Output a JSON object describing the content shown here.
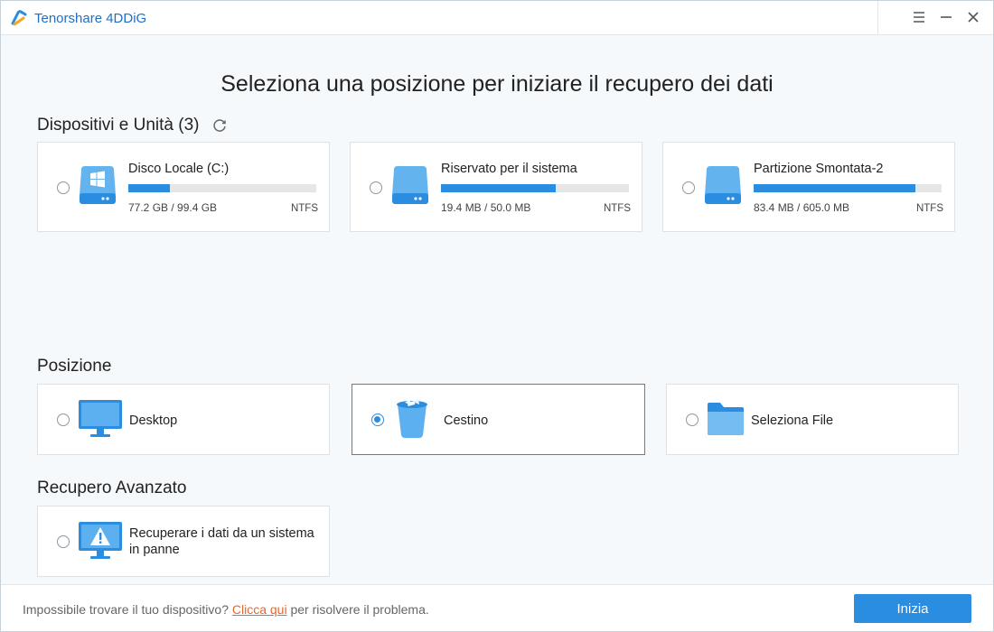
{
  "app": {
    "title": "Tenorshare 4DDiG"
  },
  "page": {
    "title": "Seleziona una posizione per iniziare il recupero dei dati"
  },
  "devices": {
    "section_title": "Dispositivi e Unità (3)",
    "items": [
      {
        "name": "Disco Locale (C:)",
        "size": "77.2 GB / 99.4 GB",
        "fs": "NTFS",
        "usage": 0.22,
        "icon": "windows-drive-icon",
        "selected": false
      },
      {
        "name": "Riservato per il sistema",
        "size": "19.4 MB / 50.0 MB",
        "fs": "NTFS",
        "usage": 0.61,
        "icon": "drive-icon",
        "selected": false
      },
      {
        "name": "Partizione Smontata-2",
        "size": "83.4 MB / 605.0 MB",
        "fs": "NTFS",
        "usage": 0.86,
        "icon": "drive-icon",
        "selected": false
      }
    ]
  },
  "location": {
    "section_title": "Posizione",
    "items": [
      {
        "label": "Desktop",
        "icon": "desktop-monitor-icon",
        "selected": false
      },
      {
        "label": "Cestino",
        "icon": "recycle-bin-icon",
        "selected": true
      },
      {
        "label": "Seleziona File",
        "icon": "folder-icon",
        "selected": false
      }
    ]
  },
  "advanced": {
    "section_title": "Recupero Avanzato",
    "items": [
      {
        "label_line1": "Recuperare i dati da un sistema",
        "label_line2": "in panne",
        "icon": "warning-monitor-icon",
        "selected": false
      }
    ]
  },
  "footer": {
    "text_before": "Impossibile trovare il tuo dispositivo? ",
    "link": "Clicca qui",
    "text_after": " per risolvere il problema.",
    "start_button": "Inizia"
  },
  "colors": {
    "accent": "#2b8de0",
    "link": "#e8662c",
    "title_blue": "#1f6fc5"
  }
}
